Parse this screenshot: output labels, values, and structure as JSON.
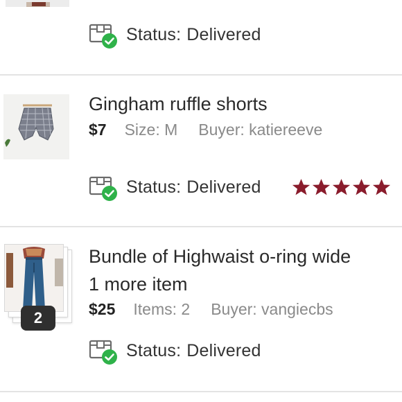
{
  "orders": [
    {
      "status_label": "Status:",
      "status_value": "Delivered"
    },
    {
      "title": "Gingham ruffle shorts",
      "price": "$7",
      "size": "Size: M",
      "buyer": "Buyer: katiereeve",
      "status_label": "Status:",
      "status_value": "Delivered",
      "rating": 5
    },
    {
      "title": "Bundle of Highwaist o-ring wide",
      "subtitle": "1 more item",
      "price": "$25",
      "items": "Items: 2",
      "buyer": "Buyer: vangiecbs",
      "status_label": "Status:",
      "status_value": "Delivered",
      "bundle_count": "2"
    }
  ],
  "colors": {
    "star": "#8a1c2c",
    "check": "#2fb24a",
    "separator": "#e3e3e3"
  },
  "icons": {
    "status": "package-delivered-icon",
    "rating": "star-icon"
  }
}
